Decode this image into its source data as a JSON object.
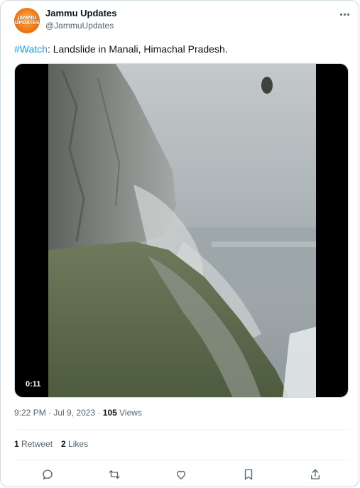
{
  "author": {
    "avatar_text": "JAMMU UPDATES",
    "name": "Jammu Updates",
    "handle": "@JammuUpdates"
  },
  "tweet": {
    "hashtag": "#Watch",
    "text": ": Landslide in Manali, Himachal Pradesh."
  },
  "media": {
    "duration": "0:11"
  },
  "meta": {
    "time": "9:22 PM",
    "sep1": " · ",
    "date": "Jul 9, 2023",
    "sep2": " · ",
    "views_count": "105",
    "views_label": " Views"
  },
  "stats": {
    "retweets_count": "1",
    "retweets_label": " Retweet",
    "likes_count": "2",
    "likes_label": " Likes"
  },
  "colors": {
    "accent": "#1d9bf0",
    "text_primary": "#0f1419",
    "text_secondary": "#536471",
    "border": "#cfd9de"
  },
  "icons": {
    "more": "more-icon",
    "reply": "reply-icon",
    "retweet": "retweet-icon",
    "like": "like-icon",
    "bookmark": "bookmark-icon",
    "share": "share-icon"
  }
}
